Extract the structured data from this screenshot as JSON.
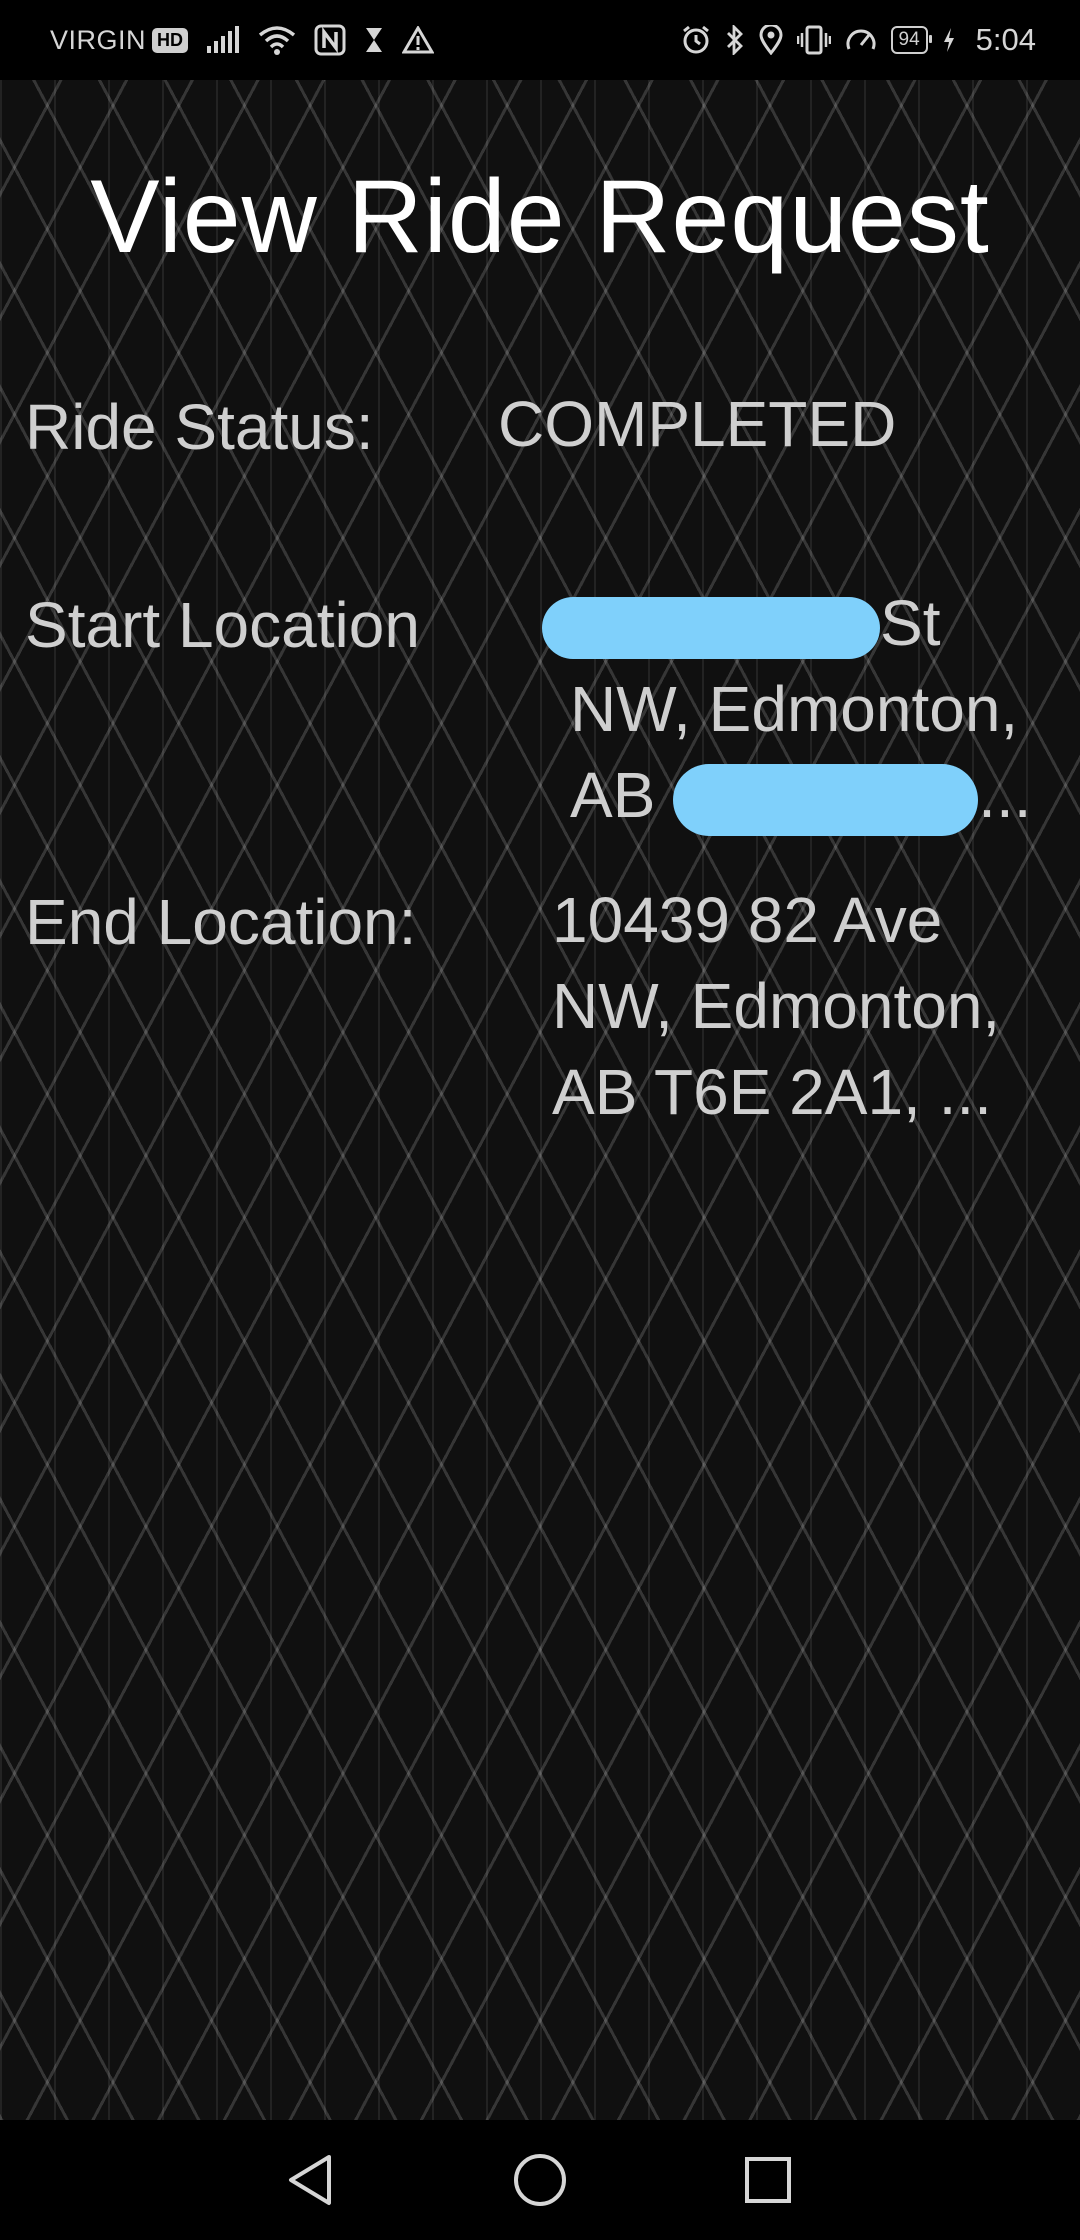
{
  "status_bar": {
    "carrier": "VIRGIN",
    "hd_badge": "HD",
    "battery": "94",
    "time": "5:04",
    "icons_left": [
      "signal-icon",
      "wifi-icon",
      "nfc-icon",
      "hourglass-icon",
      "warning-icon"
    ],
    "icons_right": [
      "alarm-icon",
      "bluetooth-icon",
      "location-icon",
      "vibrate-icon",
      "speedometer-icon",
      "battery-icon",
      "charging-icon"
    ]
  },
  "page": {
    "title": "View Ride Request"
  },
  "ride": {
    "status_label": "Ride Status:",
    "status_value": "COMPLETED",
    "start_label": "Start Location",
    "start_line1_suffix": "St",
    "start_line2": "NW, Edmonton,",
    "start_line3_prefix": "AB",
    "start_line3_suffix": "...",
    "end_label": "End Location:",
    "end_line1": "10439 82 Ave",
    "end_line2": "NW, Edmonton,",
    "end_line3": "AB T6E 2A1, ..."
  },
  "colors": {
    "background": "#101010",
    "text": "#cfcfcf",
    "title": "#ffffff",
    "redaction": "#7fd0fb"
  },
  "nav_bar": {
    "buttons": [
      "back-icon",
      "home-icon",
      "recents-icon"
    ]
  }
}
